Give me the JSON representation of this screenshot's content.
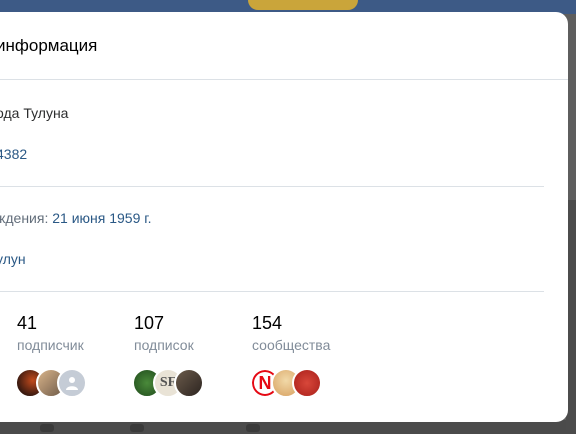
{
  "modal": {
    "title": "информация"
  },
  "info": {
    "city_line": "ода Тулуна",
    "phone": "4382",
    "birthday_label": "ждения:",
    "birthday_value": "21 июня 1959 г.",
    "hometown": "улун"
  },
  "counters": [
    {
      "value": "41",
      "label": "подписчик",
      "avatars": [
        "avatar-fire",
        "avatar-person",
        "avatar-placeholder"
      ]
    },
    {
      "value": "107",
      "label": "подписок",
      "avatars": [
        "avatar-green-logo",
        "avatar-sf-logo",
        "avatar-photo"
      ]
    },
    {
      "value": "154",
      "label": "сообщества",
      "avatars": [
        "avatar-netflix-logo",
        "avatar-girl",
        "avatar-red-logo"
      ]
    }
  ],
  "colors": {
    "link": "#2a5885",
    "muted": "#818c99",
    "divider": "#dce1e6",
    "netflix": "#e50914"
  },
  "avatar_text": {
    "netflix": "N",
    "sf": "SF"
  }
}
